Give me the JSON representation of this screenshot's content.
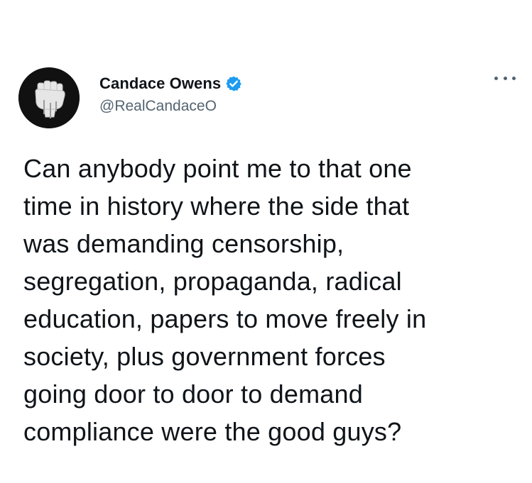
{
  "author": {
    "display_name": "Candace Owens",
    "handle": "@RealCandaceO",
    "verified": true,
    "avatar_icon": "raised-fist-icon"
  },
  "tweet": {
    "text": "Can anybody point me to that one\ntime in history where the side that\nwas demanding censorship,\nsegregation, propaganda, radical\neducation, papers to move freely in\nsociety, plus government forces\ngoing door to door to demand\ncompliance were the good guys?"
  },
  "menu": {
    "icon": "more-options-icon"
  },
  "colors": {
    "verified_blue": "#1d9bf0",
    "text_primary": "#0f1419",
    "text_secondary": "#536471"
  }
}
